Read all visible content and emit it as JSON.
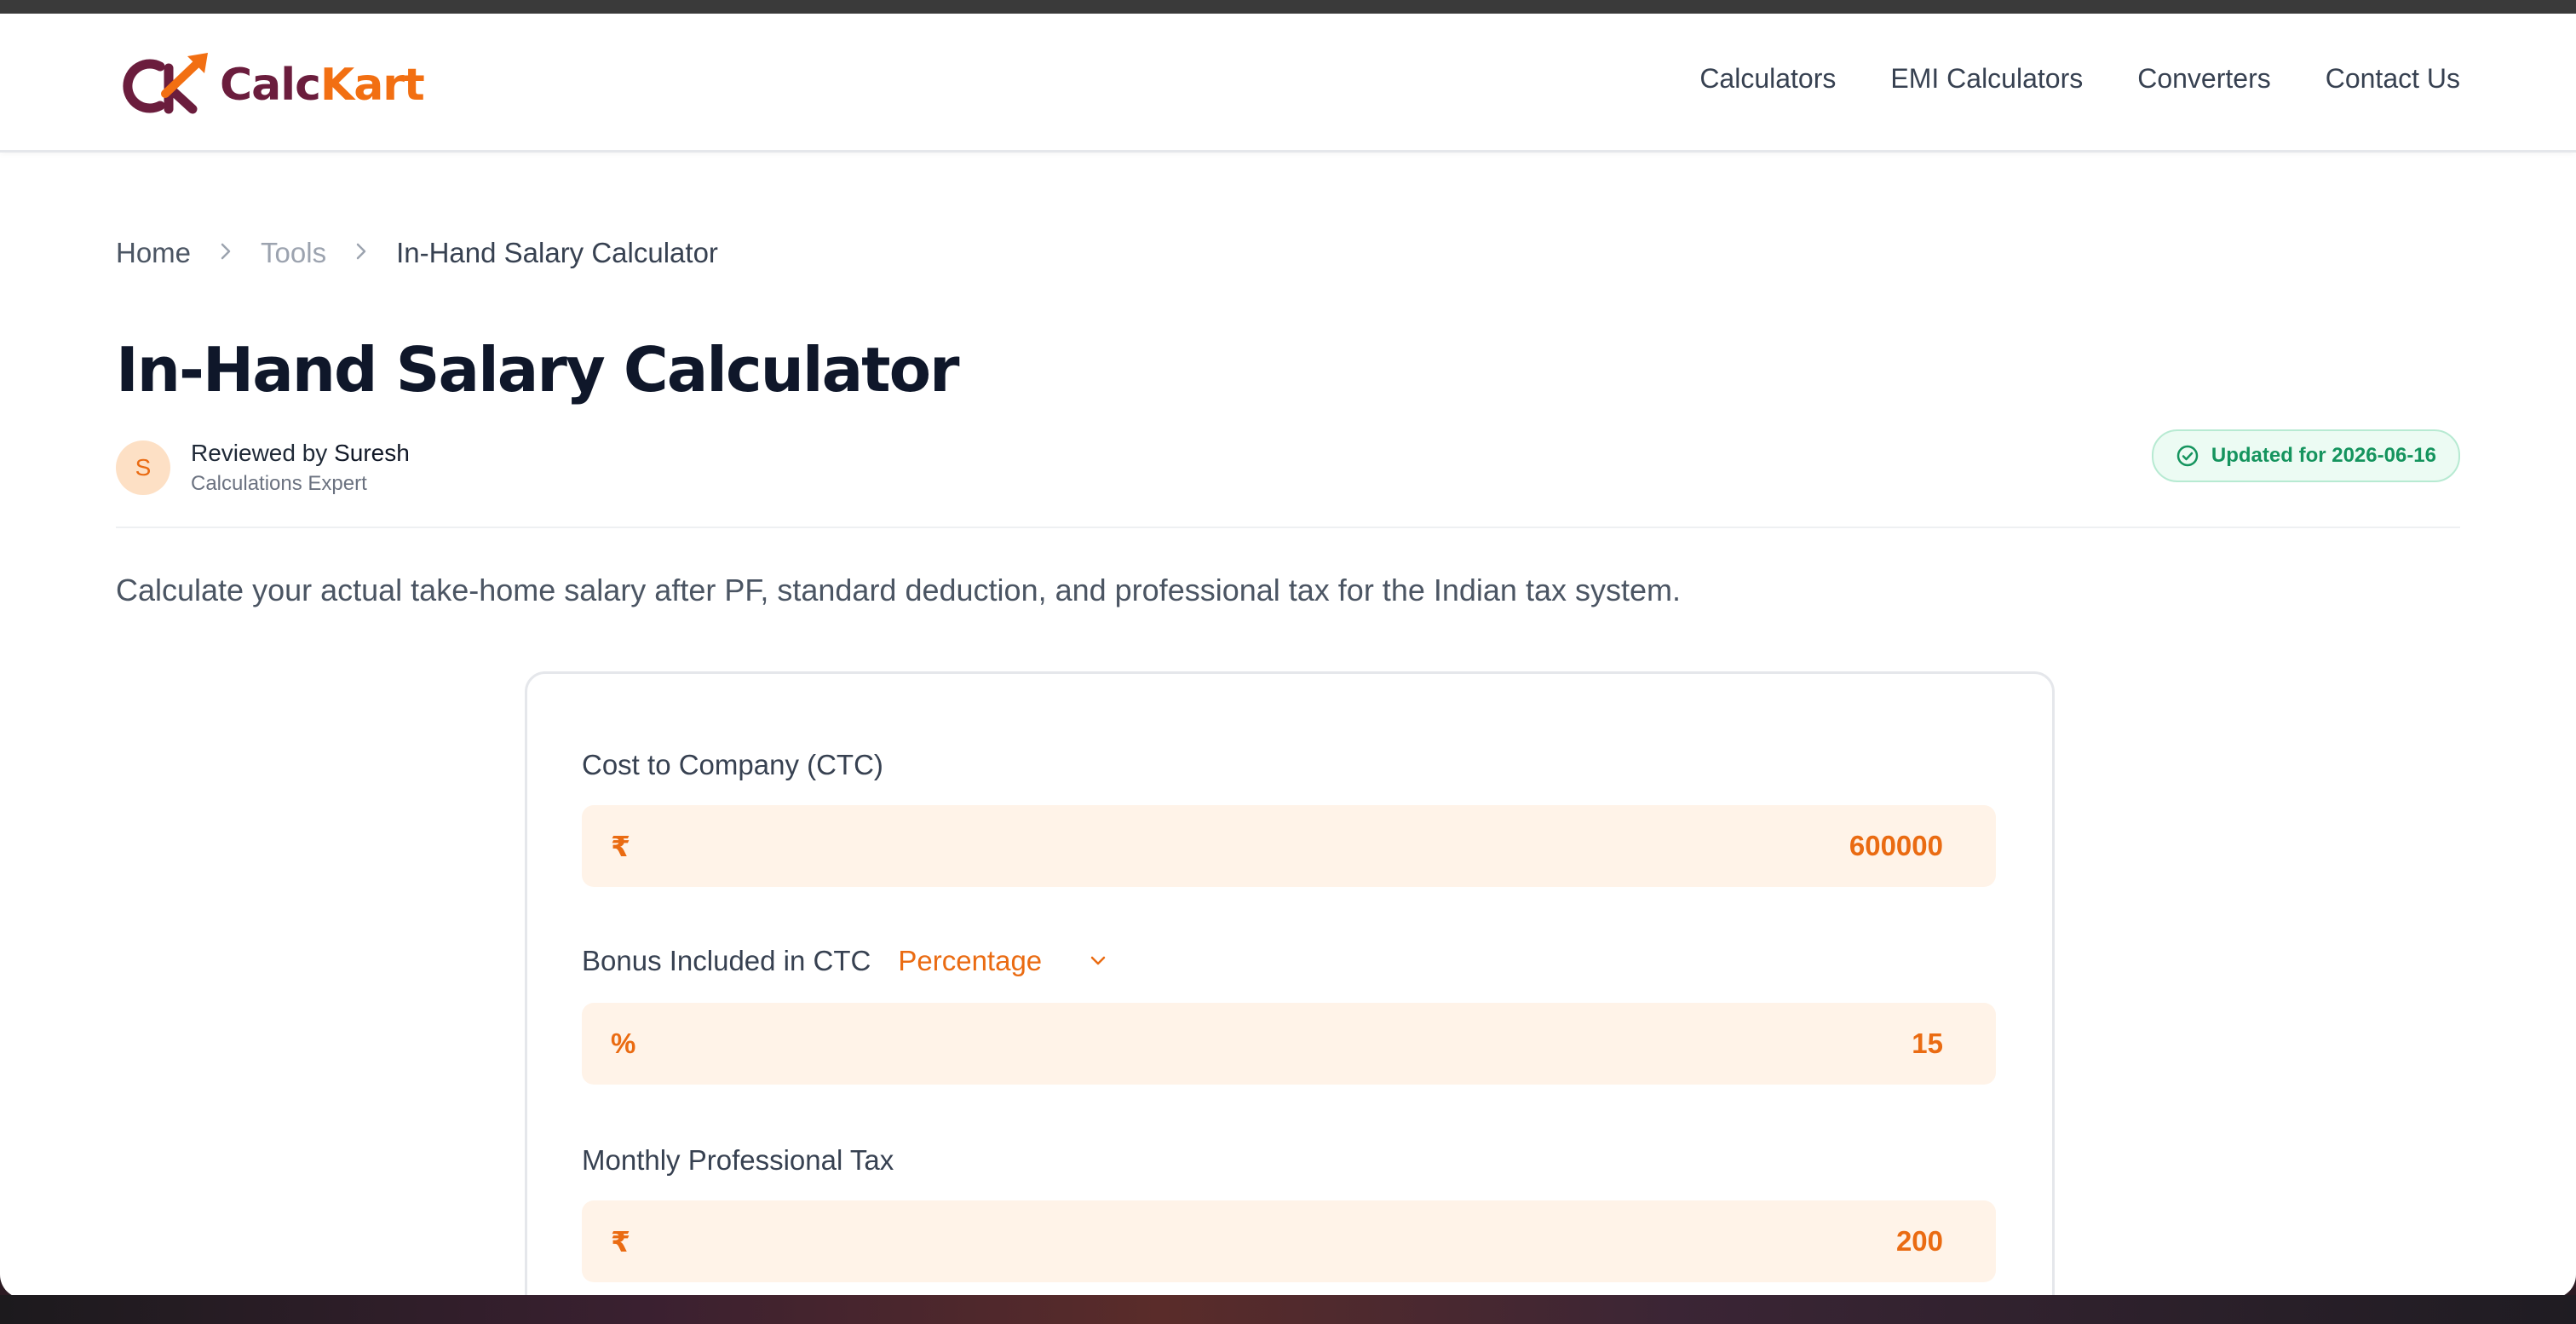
{
  "header": {
    "logo": {
      "brand_part1": "Calc",
      "brand_part2": "Kart",
      "emblem": "CK"
    },
    "nav": [
      "Calculators",
      "EMI Calculators",
      "Converters",
      "Contact Us"
    ]
  },
  "breadcrumb": {
    "home": "Home",
    "tools": "Tools",
    "current": "In-Hand Salary Calculator",
    "separator_icon": "chevron-right-icon"
  },
  "page": {
    "title": "In-Hand Salary Calculator",
    "author": {
      "avatar_initial": "S",
      "reviewed_prefix": "Reviewed by",
      "name": "Suresh",
      "role": "Calculations Expert"
    },
    "updated_badge": "Updated for 2026-06-16",
    "description": "Calculate your actual take-home salary after PF, standard deduction, and professional tax for the Indian tax system."
  },
  "form": {
    "ctc": {
      "label": "Cost to Company (CTC)",
      "prefix": "₹",
      "value": "600000"
    },
    "bonus": {
      "label": "Bonus Included in CTC",
      "type_selected": "Percentage",
      "prefix": "%",
      "value": "15"
    },
    "professional_tax": {
      "label": "Monthly Professional Tax",
      "prefix": "₹",
      "value": "200"
    }
  },
  "colors": {
    "accent": "#ea6b12",
    "brand_maroon": "#6b1d3d",
    "input_bg": "#fff3e8",
    "badge_green": "#15945e",
    "title": "#0f172a"
  }
}
